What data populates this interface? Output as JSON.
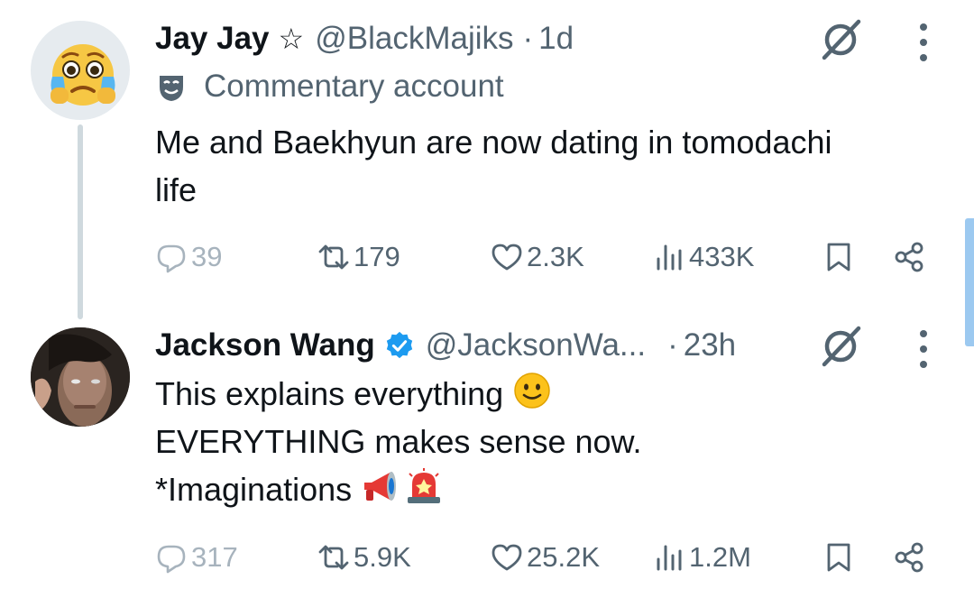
{
  "tweets": [
    {
      "name": "Jay Jay",
      "star": "☆",
      "handle": "@BlackMajiks",
      "separator": "·",
      "time": "1d",
      "label": "Commentary account",
      "text_lines": [
        "Me and Baekhyun are now dating in tomodachi",
        "life"
      ],
      "stats": {
        "replies": "39",
        "retweets": "179",
        "likes": "2.3K",
        "views": "433K"
      }
    },
    {
      "name": "Jackson Wang",
      "handle": "@JacksonWa...",
      "separator": "·",
      "time": "23h",
      "text_lines": [
        "This explains everything",
        "EVERYTHING makes sense now.",
        "*Imaginations"
      ],
      "stats": {
        "replies": "317",
        "retweets": "5.9K",
        "likes": "25.2K",
        "views": "1.2M"
      }
    }
  ],
  "icons": {
    "verified": "verified-badge-icon",
    "grok": "grok-icon",
    "more": "more-vertical-icon",
    "commentary": "theater-mask-icon",
    "reply": "reply-icon",
    "retweet": "retweet-icon",
    "like": "heart-icon",
    "views": "views-icon",
    "bookmark": "bookmark-icon",
    "share": "share-icon"
  },
  "colors": {
    "text": "#0f1419",
    "secondary": "#536471",
    "verified": "#1d9bf0",
    "thread_line": "#cfd9de",
    "scrollbar": "#9cc9f0"
  }
}
